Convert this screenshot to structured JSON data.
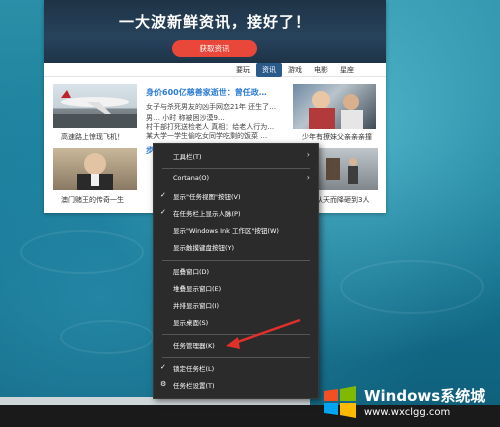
{
  "news": {
    "banner_title": "一大波新鲜资讯，接好了！",
    "banner_button": "获取资讯",
    "tabs": [
      "要玩",
      "资讯",
      "游戏",
      "电影",
      "星座"
    ],
    "active_tab": "资讯",
    "items": {
      "plane_caption": "高速路上惊现飞机！",
      "headline": "身价600亿慈善家逝世：曾任政…",
      "lines": [
        "女子与杀死男友的凶手网恋21年 还生了…",
        "男…        小时 称被困沙漠9…",
        "村干部打死送检老人 真相：给老人行为…",
        "某大学一学生偷吃女同学吃剩的饭菜 …"
      ],
      "kid_caption": "少年有撩妹父亲亲亲撞",
      "macau_caption": "澳门赌王的传奇一生",
      "chair_caption": "从天而降砸到3人",
      "blue_partial_1": "步"
    }
  },
  "context_menu": {
    "items": [
      {
        "label": "工具栏(T)",
        "checked": false,
        "submenu": true
      },
      {
        "label": "Cortana(O)",
        "checked": false,
        "submenu": true
      },
      {
        "label": "显示\"任务视图\"按钮(V)",
        "checked": true,
        "submenu": false
      },
      {
        "label": "在任务栏上显示人脉(P)",
        "checked": true,
        "submenu": false
      },
      {
        "label": "显示\"Windows Ink 工作区\"按钮(W)",
        "checked": false,
        "submenu": false
      },
      {
        "label": "显示触摸键盘按钮(Y)",
        "checked": false,
        "submenu": false
      },
      {
        "label": "层叠窗口(D)",
        "checked": false,
        "submenu": false
      },
      {
        "label": "堆叠显示窗口(E)",
        "checked": false,
        "submenu": false
      },
      {
        "label": "并排显示窗口(I)",
        "checked": false,
        "submenu": false
      },
      {
        "label": "显示桌面(S)",
        "checked": false,
        "submenu": false
      },
      {
        "label": "任务管理器(K)",
        "checked": false,
        "submenu": false
      },
      {
        "label": "锁定任务栏(L)",
        "checked": true,
        "submenu": false
      },
      {
        "label": "任务栏设置(T)",
        "checked": false,
        "submenu": false,
        "icon": "gear-icon"
      }
    ]
  },
  "watermark": {
    "title": "Windows系统城",
    "url": "www.wxclgg.com"
  },
  "colors": {
    "accent_red": "#e8473a",
    "link_blue": "#2b7bd6",
    "menu_bg": "#2b2b2b",
    "annotation_arrow": "#e0302a"
  }
}
